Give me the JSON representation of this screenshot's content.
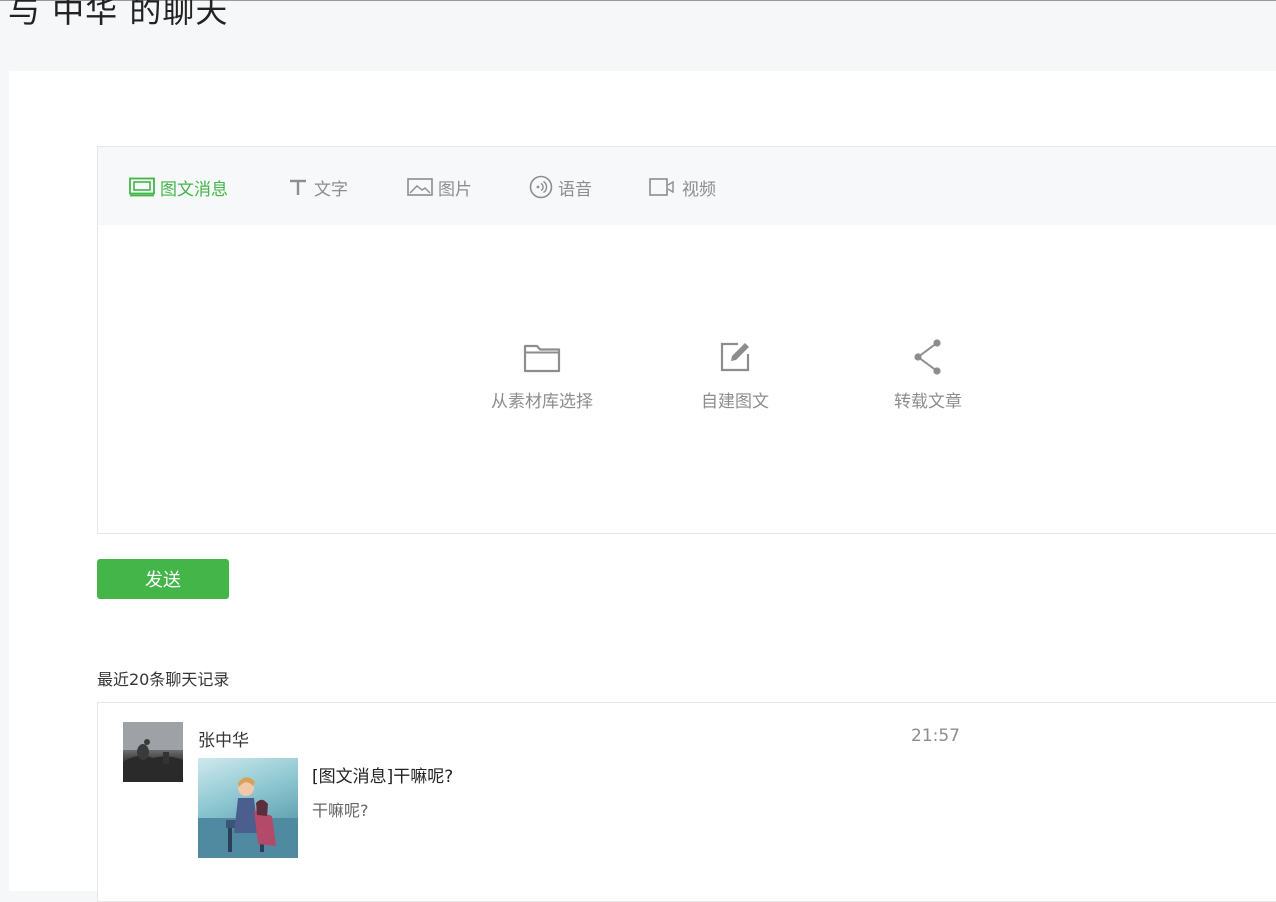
{
  "page": {
    "title": "与 中华 的聊天"
  },
  "tabs": [
    {
      "label": "图文消息",
      "icon": "news-icon",
      "active": true
    },
    {
      "label": "文字",
      "icon": "text-icon",
      "active": false
    },
    {
      "label": "图片",
      "icon": "image-icon",
      "active": false
    },
    {
      "label": "语音",
      "icon": "voice-icon",
      "active": false
    },
    {
      "label": "视频",
      "icon": "video-icon",
      "active": false
    }
  ],
  "picker": [
    {
      "label": "从素材库选择",
      "icon": "folder-icon"
    },
    {
      "label": "自建图文",
      "icon": "edit-icon"
    },
    {
      "label": "转载文章",
      "icon": "share-icon"
    }
  ],
  "send_label": "发送",
  "history": {
    "title": "最近20条聊天记录",
    "items": [
      {
        "sender": "张中华",
        "time": "21:57",
        "title": "[图文消息]干嘛呢?",
        "desc": "干嘛呢?"
      }
    ]
  },
  "colors": {
    "accent": "#44b549",
    "muted": "#8d8d8d",
    "border": "#e7e7eb"
  }
}
